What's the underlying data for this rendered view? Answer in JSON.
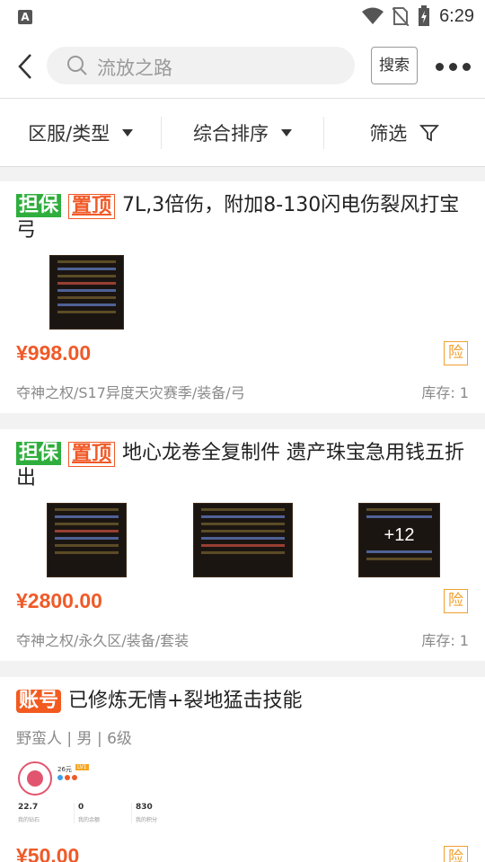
{
  "status": {
    "time": "6:29",
    "notif_letter": "A"
  },
  "search": {
    "placeholder": "流放之路",
    "button": "搜索"
  },
  "filters": [
    {
      "label": "区服/类型"
    },
    {
      "label": "综合排序"
    },
    {
      "label": "筛选"
    }
  ],
  "listings": [
    {
      "tags": [
        "担保",
        "置顶"
      ],
      "title": "7L,3倍伤，附加8-130闪电伤裂风打宝弓",
      "price": "¥998.00",
      "risk": "险",
      "category": "夺神之权/S17异度天灾赛季/装备/弓",
      "stock": "库存: 1"
    },
    {
      "tags": [
        "担保",
        "置顶"
      ],
      "title": "地心龙卷全复制件 遗产珠宝急用钱五折出",
      "price": "¥2800.00",
      "risk": "险",
      "category": "夺神之权/永久区/装备/套装",
      "stock": "库存: 1",
      "overlay": "+12"
    },
    {
      "tags": [
        "账号"
      ],
      "title": "已修炼无情+裂地猛击技能",
      "subline": "野蛮人 | 男 | 6级",
      "profile": {
        "name": "26元",
        "badge": "LV1",
        "stats": [
          {
            "value": "22.7",
            "label": "我的钻石"
          },
          {
            "value": "0",
            "label": "我的余额"
          },
          {
            "value": "830",
            "label": "我的积分"
          }
        ]
      },
      "price": "¥50.00",
      "risk": "险"
    }
  ],
  "colors": {
    "accent": "#f05a28",
    "guarantee": "#2fae3d",
    "risk": "#f0a030"
  }
}
